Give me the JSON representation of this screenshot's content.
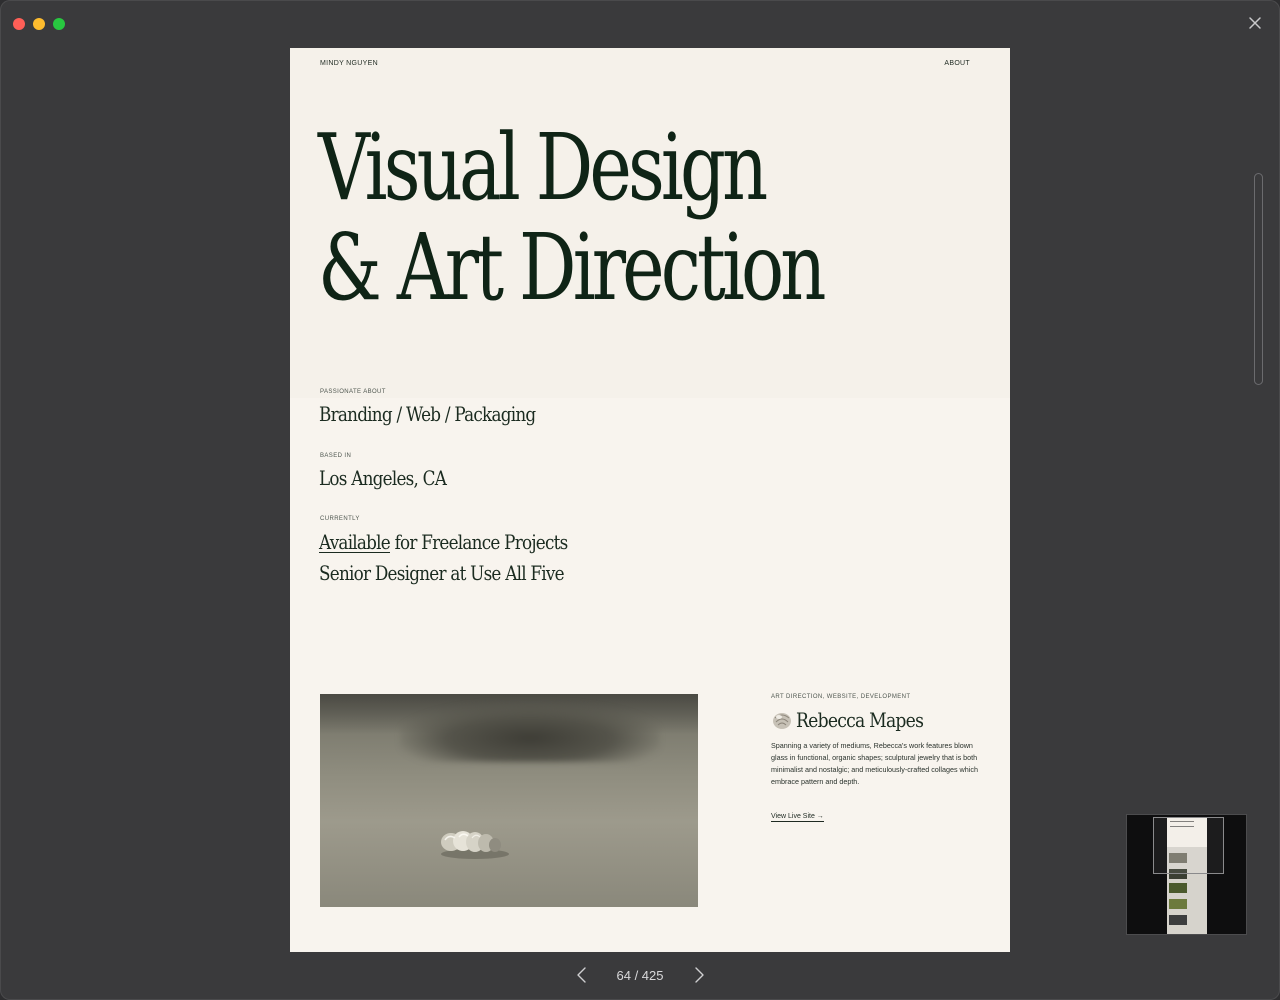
{
  "window": {
    "controls": [
      "close",
      "minimize",
      "zoom"
    ],
    "close_icon": "close-x-icon"
  },
  "page": {
    "nav": {
      "name": "MINDY NGUYEN",
      "about": "ABOUT"
    },
    "hero": {
      "line1": "Visual Design",
      "line2": "& Art Direction"
    },
    "info": {
      "passionate_label": "PASSIONATE ABOUT",
      "passionate_value": "Branding / Web / Packaging",
      "based_label": "BASED IN",
      "based_value": "Los Angeles, CA",
      "currently_label": "CURRENTLY",
      "available_word": "Available",
      "available_rest": " for Freelance Projects",
      "senior": "Senior Designer at Use All Five"
    },
    "project": {
      "meta": "ART DIRECTION, WEBSITE, DEVELOPMENT",
      "title": "Rebecca Mapes",
      "description": "Spanning a variety of mediums, Rebecca's work features blown glass in functional, organic shapes; sculptural jewelry that is both minimalist and nostalgic; and meticulously-crafted collages which embrace pattern and depth.",
      "link": "View Live Site →",
      "icon": "shell-icon"
    }
  },
  "pager": {
    "current": "64",
    "separator": "/",
    "total": "425",
    "label": "64 / 425"
  },
  "colors": {
    "background": "#3a3a3c",
    "page": "#f8f4ee",
    "hero_text": "#0f2416"
  }
}
